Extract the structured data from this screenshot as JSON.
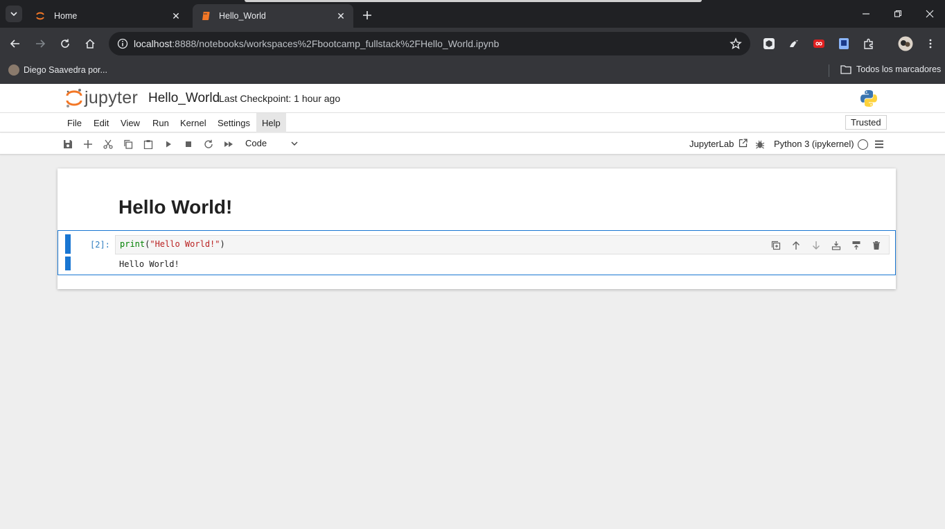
{
  "browser": {
    "tabs": [
      {
        "title": "Home",
        "active": false
      },
      {
        "title": "Hello_World",
        "active": true
      }
    ],
    "url_host": "localhost",
    "url_path": ":8888/notebooks/workspaces%2Fbootcamp_fullstack%2FHello_World.ipynb",
    "bookmark_profile": "Diego Saavedra por...",
    "all_bookmarks": "Todos los marcadores"
  },
  "jupyter": {
    "logo_text": "jupyter",
    "notebook_name": "Hello_World",
    "checkpoint": "Last Checkpoint: 1 hour ago",
    "menu": [
      "File",
      "Edit",
      "View",
      "Run",
      "Kernel",
      "Settings",
      "Help"
    ],
    "trusted": "Trusted",
    "cell_type": "Code",
    "jupyterlab_link": "JupyterLab",
    "kernel_name": "Python 3 (ipykernel)"
  },
  "notebook": {
    "heading": "Hello World!",
    "cell": {
      "prompt": "[2]:",
      "code_fn": "print",
      "code_open": "(",
      "code_str": "\"Hello World!\"",
      "code_close": ")",
      "output": "Hello World!"
    }
  },
  "colors": {
    "jupyter_orange": "#f37726",
    "active_cell": "#1976d2",
    "browser_dark": "#202124",
    "browser_toolbar": "#35363a"
  }
}
